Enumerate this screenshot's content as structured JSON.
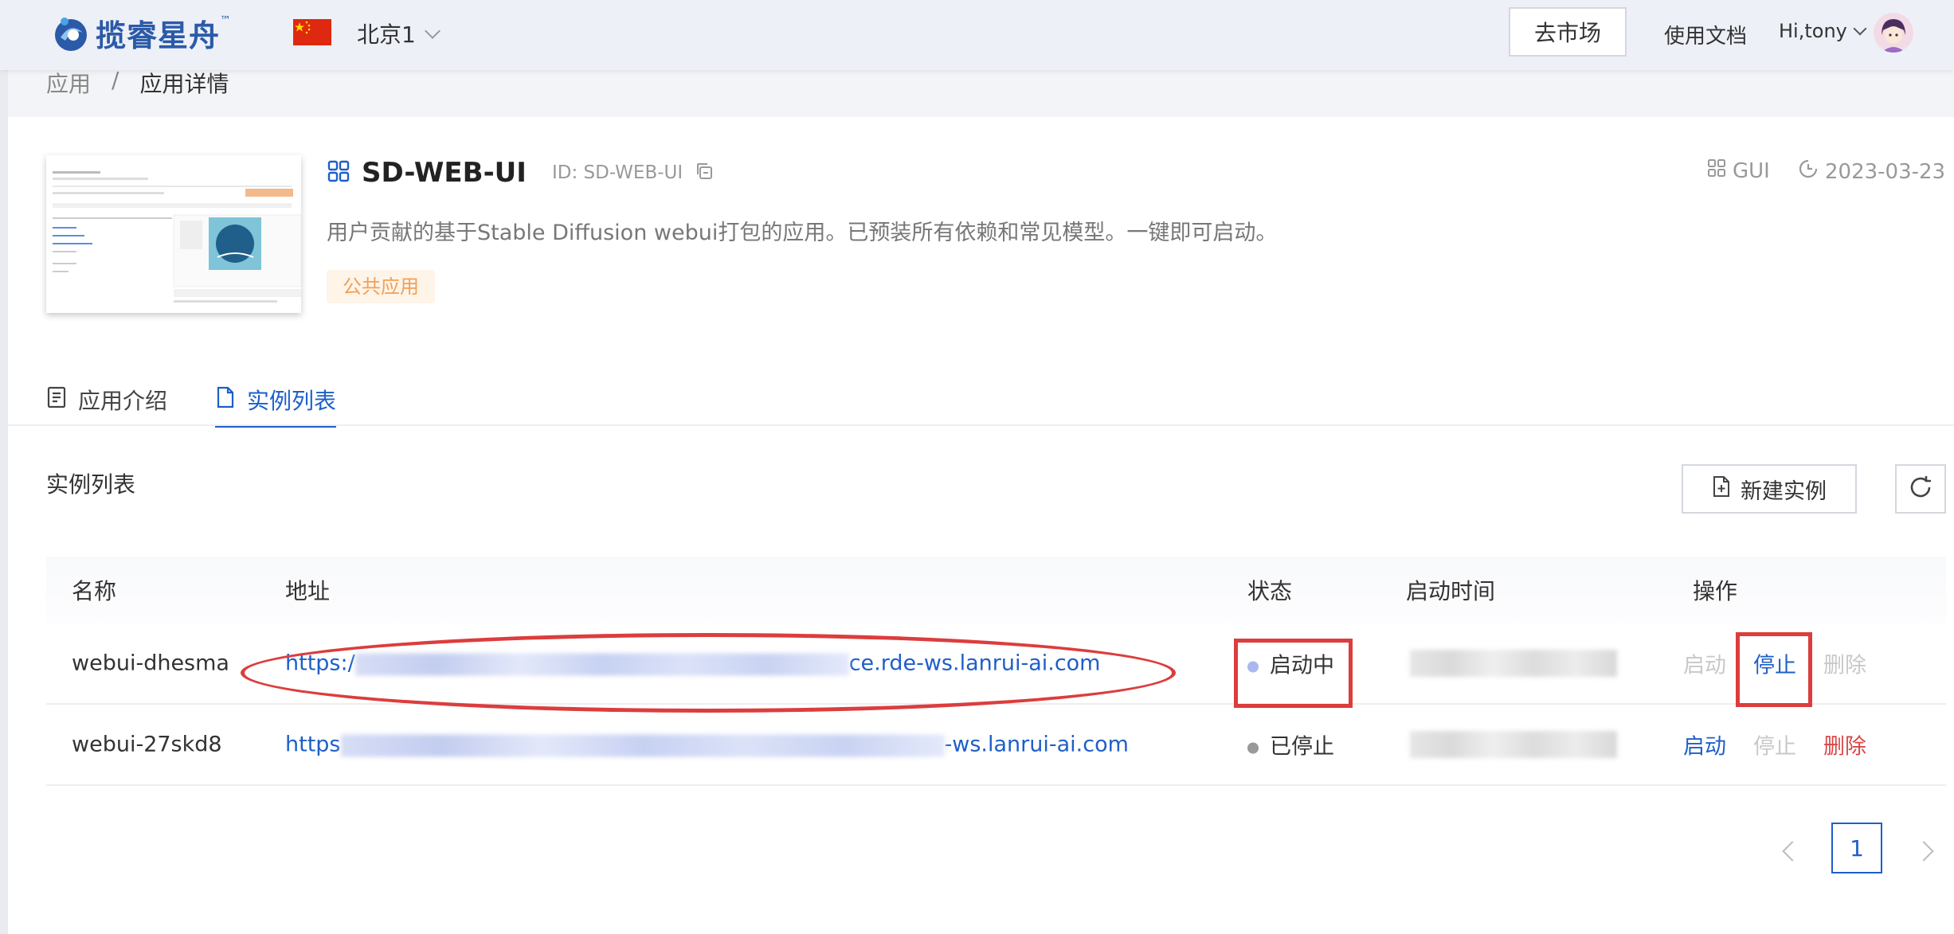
{
  "header": {
    "logo_text": "揽睿星舟",
    "logo_tm": "™",
    "region": "北京1",
    "market_button": "去市场",
    "docs_link": "使用文档",
    "user_greeting": "Hi,tony"
  },
  "breadcrumb": {
    "root": "应用",
    "separator": "/",
    "current": "应用详情"
  },
  "app": {
    "name": "SD-WEB-UI",
    "id_label": "ID: SD-WEB-UI",
    "description": "用户贡献的基于Stable Diffusion webui打包的应用。已预装所有依赖和常见模型。一键即可启动。",
    "tag": "公共应用",
    "type": "GUI",
    "date": "2023-03-23"
  },
  "tabs": [
    {
      "label": "应用介绍",
      "icon": "document-icon",
      "active": false
    },
    {
      "label": "实例列表",
      "icon": "file-icon",
      "active": true
    }
  ],
  "instances": {
    "section_title": "实例列表",
    "new_button": "新建实例",
    "columns": [
      "名称",
      "地址",
      "状态",
      "启动时间",
      "操作"
    ],
    "rows": [
      {
        "name": "webui-dhesma",
        "url_prefix": "https:/",
        "url_suffix": "ce.rde-ws.lanrui-ai.com",
        "status": "启动中",
        "status_color": "#a9b8ee",
        "actions": {
          "start": "启动",
          "stop": "停止",
          "delete": "删除"
        }
      },
      {
        "name": "webui-27skd8",
        "url_prefix": "https",
        "url_suffix": "-ws.lanrui-ai.com",
        "status": "已停止",
        "status_color": "#999999",
        "actions": {
          "start": "启动",
          "stop": "停止",
          "delete": "删除"
        }
      }
    ]
  },
  "pagination": {
    "current_page": "1"
  },
  "colors": {
    "accent": "#1e5fc8",
    "danger": "#d84545",
    "annotation": "#dc3d3d"
  }
}
